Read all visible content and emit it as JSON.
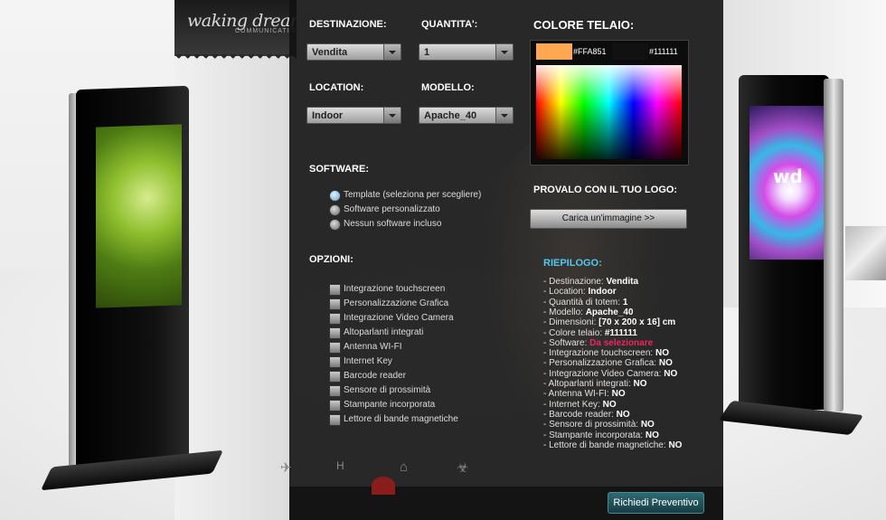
{
  "brand": {
    "name": "waking dreams",
    "tagline": "COMMUNICATION"
  },
  "form": {
    "destinazione": {
      "label": "DESTINAZIONE:",
      "value": "Vendita"
    },
    "quantita": {
      "label": "QUANTITA':",
      "value": "1"
    },
    "location": {
      "label": "LOCATION:",
      "value": "Indoor"
    },
    "modello": {
      "label": "MODELLO:",
      "value": "Apache_40"
    },
    "software": {
      "label": "SOFTWARE:",
      "options": [
        {
          "text": "Template (seleziona per scegliere)",
          "selected": true
        },
        {
          "text": "Software personalizzato",
          "selected": false
        },
        {
          "text": "Nessun software incluso",
          "selected": false
        }
      ]
    },
    "opzioni": {
      "label": "OPZIONI:",
      "items": [
        "Integrazione touchscreen",
        "Personalizzazione Grafica",
        "Integrazione Video Camera",
        "Altoparlanti integrati",
        "Antenna WI-FI",
        "Internet Key",
        "Barcode reader",
        "Sensore di prossimità",
        "Stampante incorporata",
        "Lettore di bande magnetiche"
      ]
    },
    "colore": {
      "label": "COLORE TELAIO:",
      "swatch1": {
        "hex": "#FFA851",
        "text": "#FFA851"
      },
      "swatch2": {
        "hex": "#111111",
        "text": "#111111"
      }
    },
    "logo": {
      "label": "PROVALO CON IL TUO LOGO:",
      "button": "Carica un'immagine >>"
    }
  },
  "riepilogo": {
    "title": "RIEPILOGO:",
    "lines": [
      {
        "prefix": "- Destinazione: ",
        "value": "Vendita"
      },
      {
        "prefix": "- Location: ",
        "value": "Indoor"
      },
      {
        "prefix": "- Quantità di totem: ",
        "value": "1"
      },
      {
        "prefix": "- Modello: ",
        "value": "Apache_40"
      },
      {
        "prefix": "- Dimensioni: ",
        "value": "[70 x 200 x 16] cm"
      },
      {
        "prefix": "- Colore telaio: ",
        "value": "#111111"
      },
      {
        "prefix": "- Software: ",
        "value": "Da selezionare",
        "highlight": true
      },
      {
        "prefix": "- Integrazione touchscreen: ",
        "value": "NO"
      },
      {
        "prefix": "- Personalizzazione Grafica: ",
        "value": "NO"
      },
      {
        "prefix": "- Integrazione Video Camera: ",
        "value": "NO"
      },
      {
        "prefix": "- Altoparlanti integrati: ",
        "value": "NO"
      },
      {
        "prefix": "- Antenna WI-FI: ",
        "value": "NO"
      },
      {
        "prefix": "- Internet Key: ",
        "value": "NO"
      },
      {
        "prefix": "- Barcode reader: ",
        "value": "NO"
      },
      {
        "prefix": "- Sensore di prossimità: ",
        "value": "NO"
      },
      {
        "prefix": "- Stampante incorporata: ",
        "value": "NO"
      },
      {
        "prefix": "- Lettore di bande magnetiche: ",
        "value": "NO"
      }
    ]
  },
  "actions": {
    "quote_button": "Richiedi Preventivo"
  },
  "kiosk_screen_logo": "wd",
  "bottom_icons": [
    "airplane-icon",
    "hospital-icon",
    "museum-icon",
    "biohazard-icon"
  ]
}
